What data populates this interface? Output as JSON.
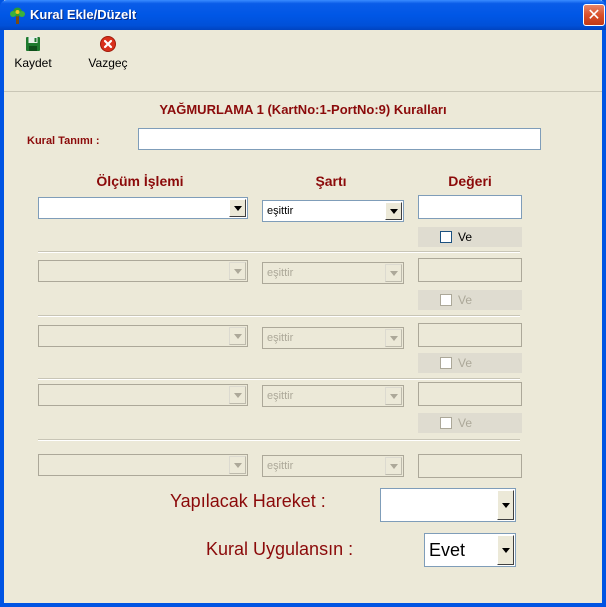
{
  "window": {
    "title": "Kural Ekle/Düzelt",
    "close_glyph": "✕",
    "colors": {
      "title_bar": "#0054e3",
      "label_red": "#8b0a0a",
      "face": "#ece9d8"
    }
  },
  "toolbar": {
    "save_label": "Kaydet",
    "save_icon": "floppy-disk-icon",
    "cancel_label": "Vazgeç",
    "cancel_icon": "cancel-x-icon"
  },
  "form": {
    "heading": "YAĞMURLAMA 1 (KartNo:1-PortNo:9) Kuralları",
    "rule_label": "Kural Tanımı :",
    "rule_value": "",
    "columns": {
      "operation": "Ölçüm İşlemi",
      "condition": "Şartı",
      "value": "Değeri"
    },
    "conditions": [
      {
        "operation": "",
        "condition": "eşittir",
        "value": "",
        "and_label": "Ve",
        "and_checked": false,
        "enabled": true
      },
      {
        "operation": "",
        "condition": "eşittir",
        "value": "",
        "and_label": "Ve",
        "and_checked": false,
        "enabled": false
      },
      {
        "operation": "",
        "condition": "eşittir",
        "value": "",
        "and_label": "Ve",
        "and_checked": false,
        "enabled": false
      },
      {
        "operation": "",
        "condition": "eşittir",
        "value": "",
        "and_label": "Ve",
        "and_checked": false,
        "enabled": false
      },
      {
        "operation": "",
        "condition": "eşittir",
        "value": "",
        "enabled": false
      }
    ],
    "action_label": "Yapılacak Hareket :",
    "action_value": "",
    "apply_label": "Kural Uygulansın :",
    "apply_value": "Evet"
  }
}
